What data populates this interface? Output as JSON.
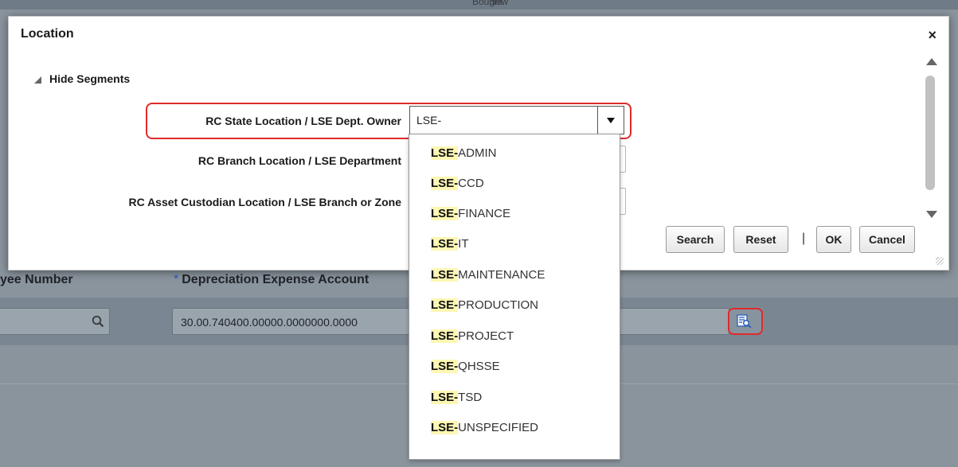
{
  "background": {
    "top_strip": {
      "bought": "Bought",
      "now": "New"
    },
    "columns": {
      "employee_number_label": "yee Number",
      "depreciation_label": "Depreciation Expense Account",
      "required_mark": "*"
    },
    "depreciation_value": "30.00.740400.00000.0000000.0000",
    "icons": {
      "search": "magnifier-icon",
      "lov": "list-of-values-search-icon"
    }
  },
  "dialog": {
    "title": "Location",
    "close_label": "×",
    "hide_segments_label": "Hide Segments",
    "segments": [
      {
        "label": "RC State Location / LSE Dept. Owner",
        "value": "LSE-"
      },
      {
        "label": "RC Branch Location / LSE Department",
        "value": ""
      },
      {
        "label": "RC Asset Custodian Location / LSE Branch or Zone",
        "value": ""
      }
    ],
    "buttons": {
      "search": "Search",
      "reset": "Reset",
      "separator": "|",
      "ok": "OK",
      "cancel": "Cancel"
    }
  },
  "dropdown": {
    "match_text": "LSE-",
    "items": [
      "ADMIN",
      "CCD",
      "FINANCE",
      "IT",
      "MAINTENANCE",
      "PRODUCTION",
      "PROJECT",
      "QHSSE",
      "TSD",
      "UNSPECIFIED"
    ]
  },
  "colors": {
    "highlight_border": "#e02a2a",
    "match_bg": "#fdf7b4",
    "required": "#2a5fb5"
  }
}
